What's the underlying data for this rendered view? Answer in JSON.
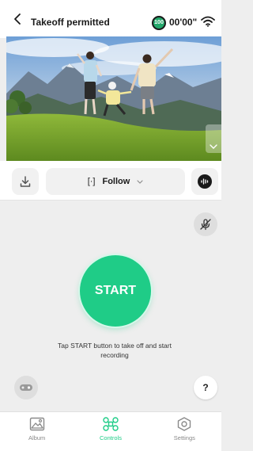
{
  "header": {
    "title": "Takeoff permitted",
    "battery_level": "100",
    "flight_time": "00'00\""
  },
  "toolbar": {
    "follow_label": "Follow",
    "follow_icon": "[·]"
  },
  "controls": {
    "start_label": "START",
    "hint": "Tap START button to take off and start recording",
    "help_label": "?"
  },
  "nav": {
    "items": [
      {
        "label": "Album",
        "icon": "album-icon"
      },
      {
        "label": "Controls",
        "icon": "drone-icon",
        "active": true
      },
      {
        "label": "Settings",
        "icon": "settings-icon"
      }
    ]
  },
  "colors": {
    "accent": "#1fcc87",
    "battery": "#23a86b"
  }
}
